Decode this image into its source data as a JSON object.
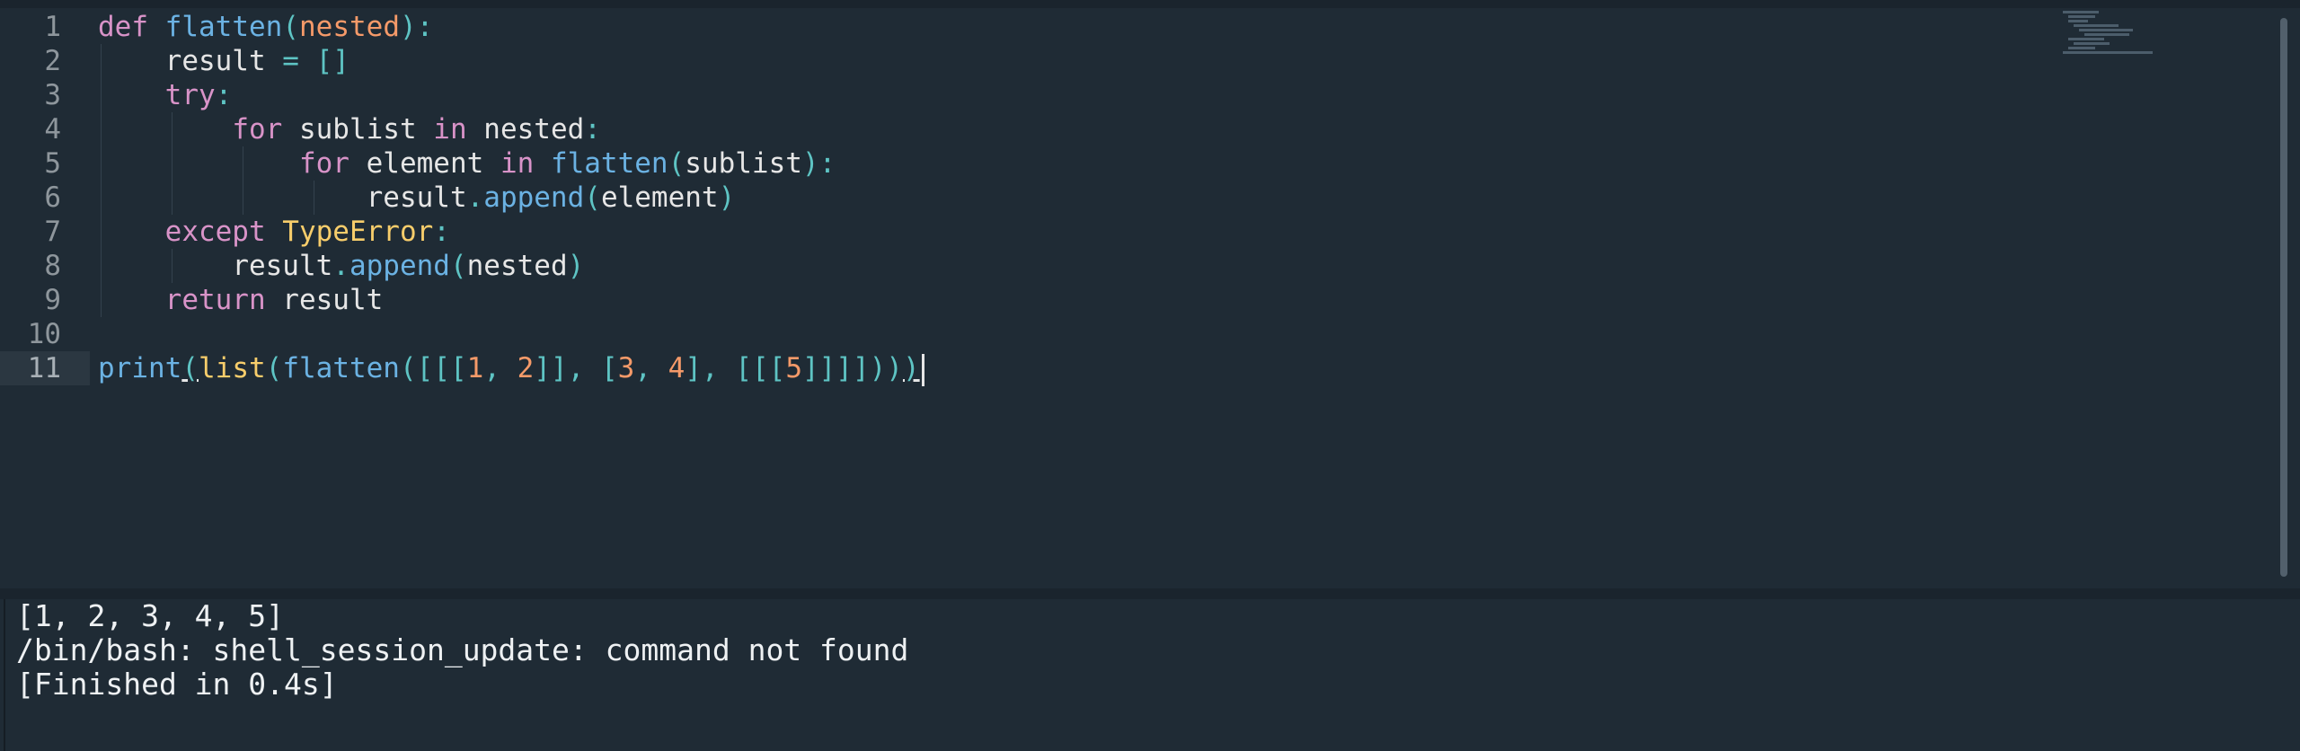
{
  "editor": {
    "line_numbers": [
      "1",
      "2",
      "3",
      "4",
      "5",
      "6",
      "7",
      "8",
      "9",
      "10",
      "11"
    ],
    "code": {
      "l1": {
        "kw": "def",
        "fn": "flatten",
        "p1": "(",
        "param": "nested",
        "p2": "):"
      },
      "l2": {
        "txt": "result",
        "op": " =",
        "br": " []"
      },
      "l3": {
        "kw": "try",
        "p": ":"
      },
      "l4": {
        "kw": "for",
        "t1": " sublist ",
        "kw2": "in",
        "t2": " nested",
        "p": ":"
      },
      "l5": {
        "kw": "for",
        "t1": " element ",
        "kw2": "in",
        "fn": " flatten",
        "p1": "(",
        "t2": "sublist",
        "p2": "):"
      },
      "l6": {
        "t1": "result",
        "p1": ".",
        "fn": "append",
        "p2": "(",
        "t2": "element",
        "p3": ")"
      },
      "l7": {
        "kw": "except",
        "cls": " TypeError",
        "p": ":"
      },
      "l8": {
        "t1": "result",
        "p1": ".",
        "fn": "append",
        "p2": "(",
        "t2": "nested",
        "p3": ")"
      },
      "l9": {
        "kw": "return",
        "t1": " result"
      },
      "l11": {
        "print": "print",
        "open1": "(",
        "list": "list",
        "open2": "(",
        "flatten": "flatten",
        "open3": "(",
        "b1": "[[[",
        "n1": "1",
        "c1": ", ",
        "n2": "2",
        "b2": "]], [",
        "n3": "3",
        "c2": ", ",
        "n4": "4",
        "b3": "], [[[",
        "n5": "5",
        "b4": "]]]]",
        "close": "))",
        "close_last": ")"
      }
    }
  },
  "output": {
    "lines": [
      "[1, 2, 3, 4, 5]",
      "/bin/bash: shell_session_update: command not found",
      "[Finished in 0.4s]"
    ]
  }
}
